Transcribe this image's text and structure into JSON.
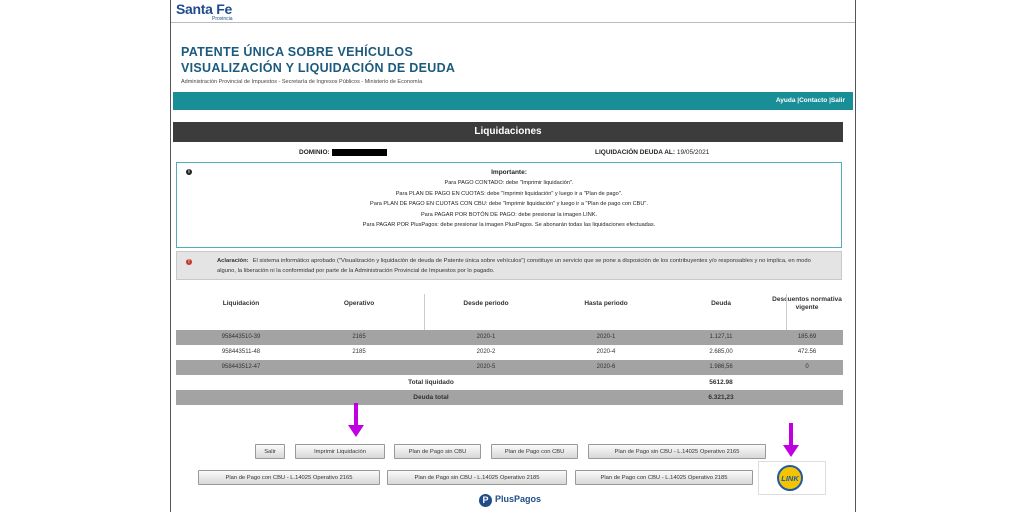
{
  "header": {
    "logo_main": "Santa Fe",
    "logo_sub": "Provincia",
    "title_line1": "PATENTE ÚNICA SOBRE VEHÍCULOS",
    "title_line2": "VISUALIZACIÓN Y LIQUIDACIÓN DE DEUDA",
    "subtitle": "Administración Provincial de Impuestos - Secretaría de Ingresos Públicos - Ministerio de Economía"
  },
  "nav": {
    "ayuda": "Ayuda",
    "contacto": "Contacto",
    "salir": "Salir"
  },
  "section_title": "Liquidaciones",
  "meta": {
    "dominio_label": "DOMINIO:",
    "liquidacion_label": "LIQUIDACIÓN DEUDA AL:",
    "liquidacion_date": "19/05/2021"
  },
  "info": {
    "title": "Importante:",
    "lines": [
      "Para PAGO CONTADO: debe \"Imprimir liquidación\".",
      "Para PLAN DE PAGO EN CUOTAS: debe \"Imprimir liquidación\" y luego ir a \"Plan de pago\".",
      "Para PLAN DE PAGO EN CUOTAS CON CBU: debe \"Imprimir liquidación\" y luego ir a \"Plan de pago con CBU\".",
      "Para PAGAR POR BOTÓN DE PAGO: debe presionar la imagen LINK.",
      "Para PAGAR POR PlusPagos: debe presionar la imagen PlusPagos. Se abonarán todas las liquidaciones efectuadas."
    ]
  },
  "warning": {
    "label": "Aclaración:",
    "text": "El sistema informático aprobado (\"Visualización y liquidación de deuda de Patente única sobre vehículos\") constituye un servicio que se pone a disposición de los contribuyentes y/o responsables y no implica, en modo alguno, la liberación ni la conformidad por parte de la Administración Provincial de Impuestos por lo pagado."
  },
  "table": {
    "headers": [
      "Liquidación",
      "Operativo",
      "Desde periodo",
      "Hasta periodo",
      "Deuda",
      "Descuentos normativa vigente"
    ],
    "rows": [
      [
        "958443510-39",
        "2165",
        "2020-1",
        "2020-1",
        "1.127,11",
        "185.69"
      ],
      [
        "958443511-48",
        "2185",
        "2020-2",
        "2020-4",
        "2.685,00",
        "472.56"
      ],
      [
        "958443512-47",
        "",
        "2020-5",
        "2020-6",
        "1.986,56",
        "0"
      ]
    ],
    "total_liquidado_label": "Total liquidado",
    "total_liquidado_value": "5612.98",
    "deuda_total_label": "Deuda total",
    "deuda_total_value": "6.321,23"
  },
  "buttons": {
    "salir": "Salir",
    "imprimir": "Imprimir Liquidación",
    "plan_sin_cbu": "Plan de Pago sin CBU",
    "plan_con_cbu": "Plan de Pago con CBU",
    "plan_sin_cbu_2165": "Plan de Pago sin CBU - L.14025 Operativo 2165",
    "plan_con_cbu_2165": "Plan de Pago con CBU - L.14025 Operativo 2165",
    "plan_sin_cbu_2185": "Plan de Pago sin CBU - L.14025 Operativo 2185",
    "plan_con_cbu_2185": "Plan de Pago con CBU - L.14025 Operativo 2185",
    "link": "LINK",
    "pluspagos": "PlusPagos"
  },
  "colors": {
    "teal": "#1a8e96",
    "dark_bar": "#3c3c3c",
    "arrow": "#c000e0",
    "title_blue": "#1c5a7d"
  }
}
